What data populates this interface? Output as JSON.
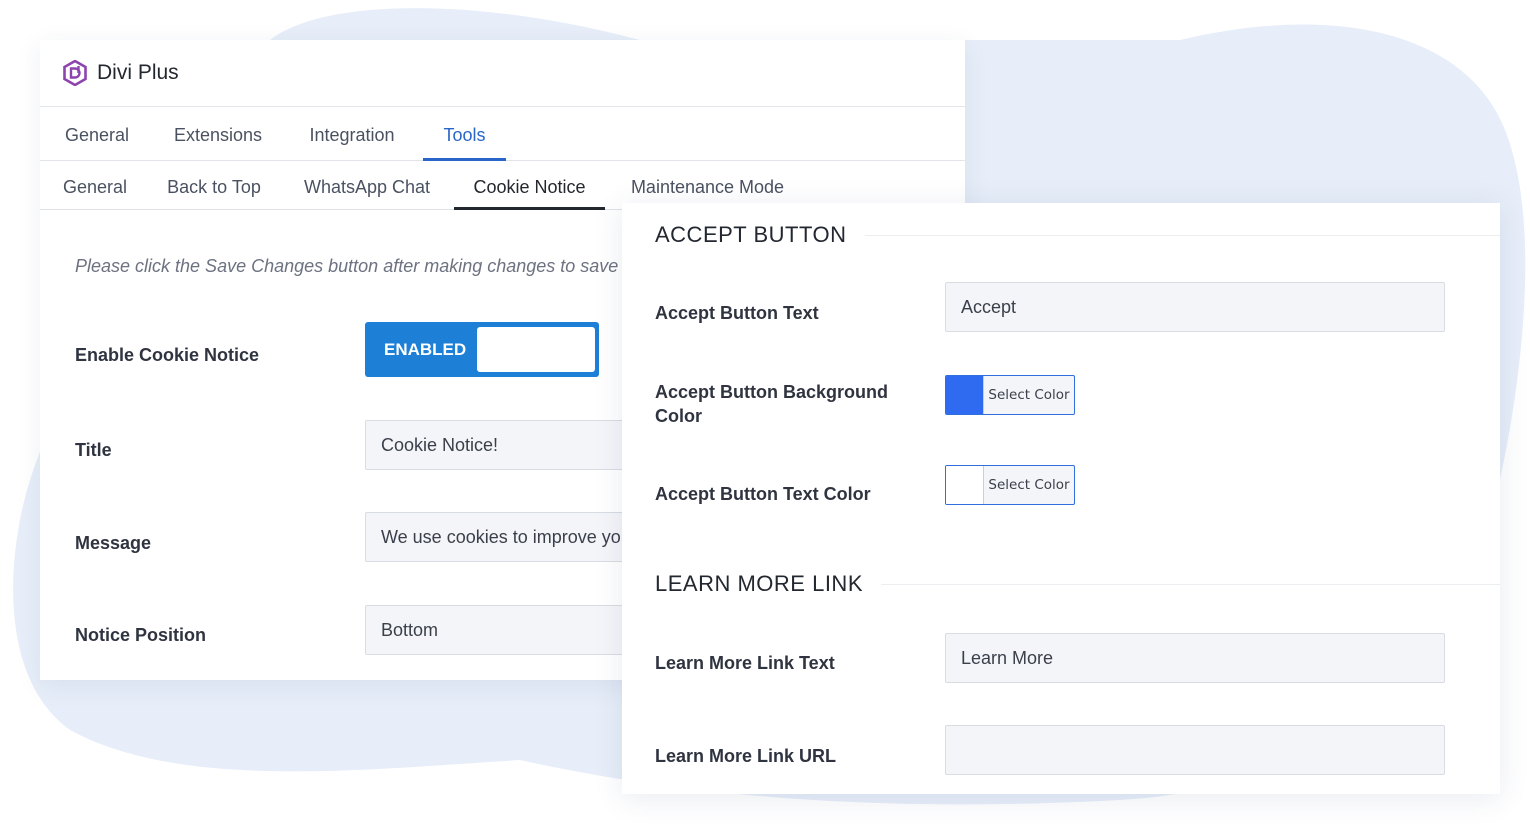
{
  "brand": {
    "name": "Divi Plus",
    "logo_icon": "divi-plus-logo-icon",
    "logo_color": "#8e44ad"
  },
  "tabs": [
    {
      "label": "General",
      "active": false
    },
    {
      "label": "Extensions",
      "active": false
    },
    {
      "label": "Integration",
      "active": false
    },
    {
      "label": "Tools",
      "active": true
    }
  ],
  "subtabs": [
    {
      "label": "General",
      "active": false
    },
    {
      "label": "Back to Top",
      "active": false
    },
    {
      "label": "WhatsApp Chat",
      "active": false
    },
    {
      "label": "Cookie Notice",
      "active": true
    },
    {
      "label": "Maintenance Mode",
      "active": false
    }
  ],
  "notice": "Please click the Save Changes button after making changes to save s",
  "cookie_settings": {
    "enable_label": "Enable Cookie Notice",
    "toggle_label": "ENABLED",
    "toggle_on": true,
    "title_label": "Title",
    "title_value": "Cookie Notice!",
    "message_label": "Message",
    "message_value": "We use cookies to improve yo",
    "position_label": "Notice Position",
    "position_value": "Bottom"
  },
  "accept_button": {
    "section_title": "ACCEPT BUTTON",
    "text_label": "Accept Button Text",
    "text_value": "Accept",
    "bg_color_label": "Accept Button Background Color",
    "bg_color": "#2f6bf0",
    "text_color_label": "Accept Button Text Color",
    "text_color": "#ffffff",
    "select_color_label": "Select Color"
  },
  "learn_more": {
    "section_title": "LEARN MORE LINK",
    "text_label": "Learn More Link Text",
    "text_value": "Learn More",
    "url_label": "Learn More Link URL",
    "url_value": ""
  },
  "colors": {
    "accent": "#2a66c9",
    "toggle": "#1d7fd6",
    "blob": "#e7eef9"
  }
}
